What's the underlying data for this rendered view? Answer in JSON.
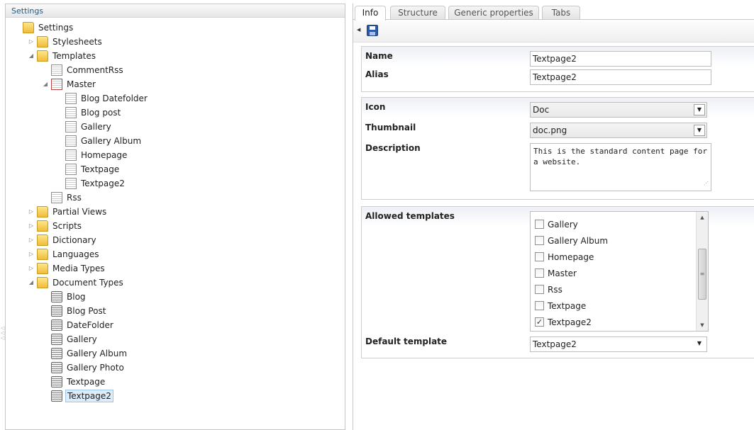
{
  "tree": {
    "header": "Settings",
    "nodes": [
      {
        "label": "Settings",
        "icon": "folder-icon",
        "expander": ""
      },
      {
        "label": "Stylesheets",
        "icon": "folder-icon",
        "expander": "collapsed"
      },
      {
        "label": "Templates",
        "icon": "folder-icon",
        "expander": "expanded"
      },
      {
        "label": "CommentRss",
        "icon": "template-icon",
        "expander": ""
      },
      {
        "label": "Master",
        "icon": "template-icon",
        "expander": "expanded"
      },
      {
        "label": "Blog Datefolder",
        "icon": "template-icon",
        "expander": ""
      },
      {
        "label": "Blog post",
        "icon": "template-icon",
        "expander": ""
      },
      {
        "label": "Gallery",
        "icon": "template-icon",
        "expander": ""
      },
      {
        "label": "Gallery Album",
        "icon": "template-icon",
        "expander": ""
      },
      {
        "label": "Homepage",
        "icon": "template-icon",
        "expander": ""
      },
      {
        "label": "Textpage",
        "icon": "template-icon",
        "expander": ""
      },
      {
        "label": "Textpage2",
        "icon": "template-icon",
        "expander": ""
      },
      {
        "label": "Rss",
        "icon": "template-icon",
        "expander": ""
      },
      {
        "label": "Partial Views",
        "icon": "folder-icon",
        "expander": "collapsed"
      },
      {
        "label": "Scripts",
        "icon": "folder-icon",
        "expander": "collapsed"
      },
      {
        "label": "Dictionary",
        "icon": "folder-icon",
        "expander": "collapsed"
      },
      {
        "label": "Languages",
        "icon": "folder-icon",
        "expander": "collapsed"
      },
      {
        "label": "Media Types",
        "icon": "folder-icon",
        "expander": "collapsed"
      },
      {
        "label": "Document Types",
        "icon": "folder-icon",
        "expander": "expanded"
      },
      {
        "label": "Blog",
        "icon": "document-type-icon",
        "expander": ""
      },
      {
        "label": "Blog Post",
        "icon": "document-type-icon",
        "expander": ""
      },
      {
        "label": "DateFolder",
        "icon": "document-type-icon",
        "expander": ""
      },
      {
        "label": "Gallery",
        "icon": "document-type-icon",
        "expander": ""
      },
      {
        "label": "Gallery Album",
        "icon": "document-type-icon",
        "expander": ""
      },
      {
        "label": "Gallery Photo",
        "icon": "document-type-icon",
        "expander": ""
      },
      {
        "label": "Textpage",
        "icon": "document-type-icon",
        "expander": ""
      },
      {
        "label": "Textpage2",
        "icon": "document-type-icon",
        "expander": "",
        "selected": true
      }
    ]
  },
  "tabs": [
    {
      "label": "Info",
      "active": true
    },
    {
      "label": "Structure"
    },
    {
      "label": "Generic properties"
    },
    {
      "label": "Tabs"
    }
  ],
  "toolbar": {
    "save_icon": "save-icon"
  },
  "form": {
    "name_label": "Name",
    "name_value": "Textpage2",
    "alias_label": "Alias",
    "alias_value": "Textpage2",
    "icon_label": "Icon",
    "icon_value": "Doc",
    "thumbnail_label": "Thumbnail",
    "thumbnail_value": "doc.png",
    "description_label": "Description",
    "description_value": "This is the standard content page for a website.",
    "allowed_templates_label": "Allowed templates",
    "allowed_templates": [
      {
        "label": "Gallery",
        "checked": false
      },
      {
        "label": "Gallery Album",
        "checked": false
      },
      {
        "label": "Homepage",
        "checked": false
      },
      {
        "label": "Master",
        "checked": false
      },
      {
        "label": "Rss",
        "checked": false
      },
      {
        "label": "Textpage",
        "checked": false
      },
      {
        "label": "Textpage2",
        "checked": true
      }
    ],
    "default_template_label": "Default template",
    "default_template_value": "Textpage2"
  },
  "colors": {
    "header_text": "#1f5c86",
    "selection": "#dcecfb"
  }
}
